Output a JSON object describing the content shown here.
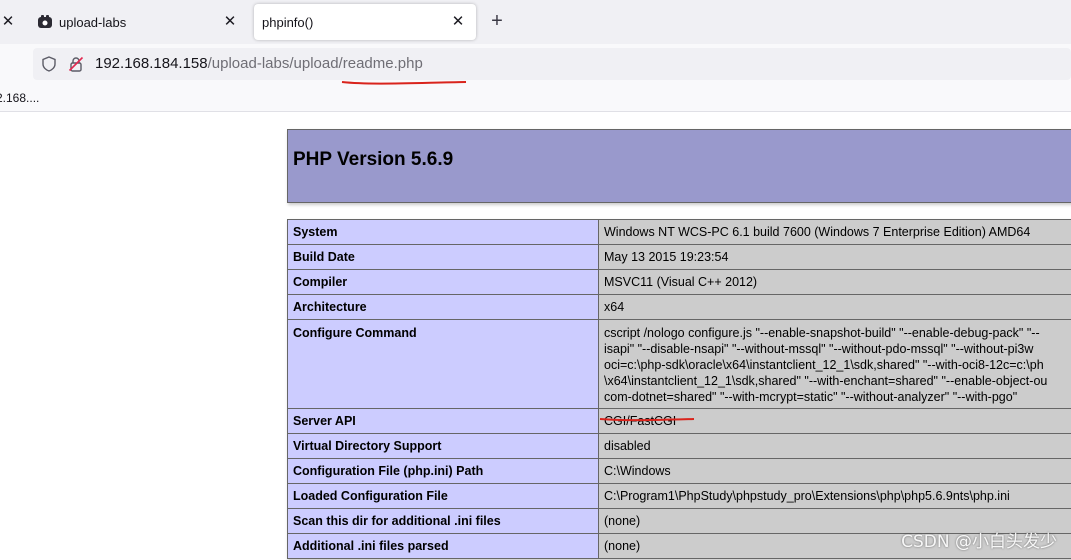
{
  "tabs": [
    {
      "label": "upload-labs",
      "icon": "upload-labs-favicon"
    },
    {
      "label": "phpinfo()",
      "active": true
    }
  ],
  "navbar": {
    "url_host": "192.168.184.158",
    "url_path": "/upload-labs/upload/readme.php"
  },
  "bookmarks": {
    "item": "2.168...."
  },
  "phpinfo": {
    "version": "PHP Version 5.6.9",
    "rows": [
      {
        "key": "System",
        "value": [
          "Windows NT WCS-PC 6.1 build 7600 (Windows 7 Enterprise Edition) AMD64"
        ]
      },
      {
        "key": "Build Date",
        "value": [
          "May 13 2015 19:23:54"
        ]
      },
      {
        "key": "Compiler",
        "value": [
          "MSVC11 (Visual C++ 2012)"
        ]
      },
      {
        "key": "Architecture",
        "value": [
          "x64"
        ]
      },
      {
        "key": "Configure Command",
        "value": [
          "cscript /nologo configure.js \"--enable-snapshot-build\" \"--enable-debug-pack\" \"--",
          "isapi\" \"--disable-nsapi\" \"--without-mssql\" \"--without-pdo-mssql\" \"--without-pi3w",
          "oci=c:\\php-sdk\\oracle\\x64\\instantclient_12_1\\sdk,shared\" \"--with-oci8-12c=c:\\ph",
          "\\x64\\instantclient_12_1\\sdk,shared\" \"--with-enchant=shared\" \"--enable-object-ou",
          "com-dotnet=shared\" \"--with-mcrypt=static\" \"--without-analyzer\" \"--with-pgo\""
        ]
      },
      {
        "key": "Server API",
        "value": [
          "CGI/FastCGI"
        ]
      },
      {
        "key": "Virtual Directory Support",
        "value": [
          "disabled"
        ]
      },
      {
        "key": "Configuration File (php.ini) Path",
        "value": [
          "C:\\Windows"
        ]
      },
      {
        "key": "Loaded Configuration File",
        "value": [
          "C:\\Program1\\PhpStudy\\phpstudy_pro\\Extensions\\php\\php5.6.9nts\\php.ini"
        ]
      },
      {
        "key": "Scan this dir for additional .ini files",
        "value": [
          "(none)"
        ]
      },
      {
        "key": "Additional .ini files parsed",
        "value": [
          "(none)"
        ]
      }
    ]
  },
  "watermark": "CSDN @小白头发少",
  "colors": {
    "php_header": "#9999cc",
    "key_cell": "#ccccff",
    "value_cell": "#cccccc",
    "annotation": "#d9241c"
  }
}
